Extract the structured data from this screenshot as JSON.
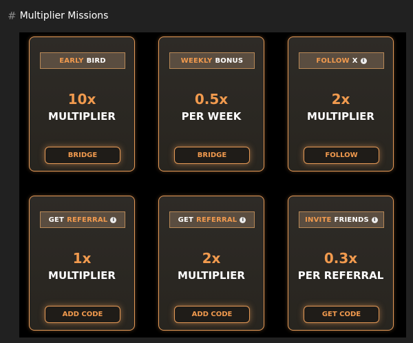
{
  "header": {
    "hash": "#",
    "title": "Multiplier Missions"
  },
  "colors": {
    "accent": "#f19a4e",
    "panel": "#000000",
    "background": "#212121"
  },
  "missions": [
    {
      "tag_highlight": "EARLY",
      "tag_rest": "BIRD",
      "value": "10x",
      "label": "MULTIPLIER",
      "button": "BRIDGE"
    },
    {
      "tag_highlight": "WEEKLY",
      "tag_rest": "BONUS",
      "value": "0.5x",
      "label": "PER WEEK",
      "button": "BRIDGE"
    },
    {
      "tag_highlight": "FOLLOW",
      "tag_rest": "X",
      "info_icon": "info-icon",
      "value": "2x",
      "label": "MULTIPLIER",
      "button": "FOLLOW"
    },
    {
      "tag_highlight": "REFERRAL",
      "tag_prefix": "GET",
      "info_icon": "info-icon",
      "value": "1x",
      "label": "MULTIPLIER",
      "button": "ADD CODE"
    },
    {
      "tag_highlight": "REFERRAL",
      "tag_prefix": "GET",
      "info_icon": "info-icon",
      "value": "2x",
      "label": "MULTIPLIER",
      "button": "ADD CODE"
    },
    {
      "tag_highlight": "INVITE",
      "tag_rest": "FRIENDS",
      "info_icon": "info-icon",
      "value": "0.3x",
      "label": "PER REFERRAL",
      "button": "GET CODE"
    }
  ]
}
